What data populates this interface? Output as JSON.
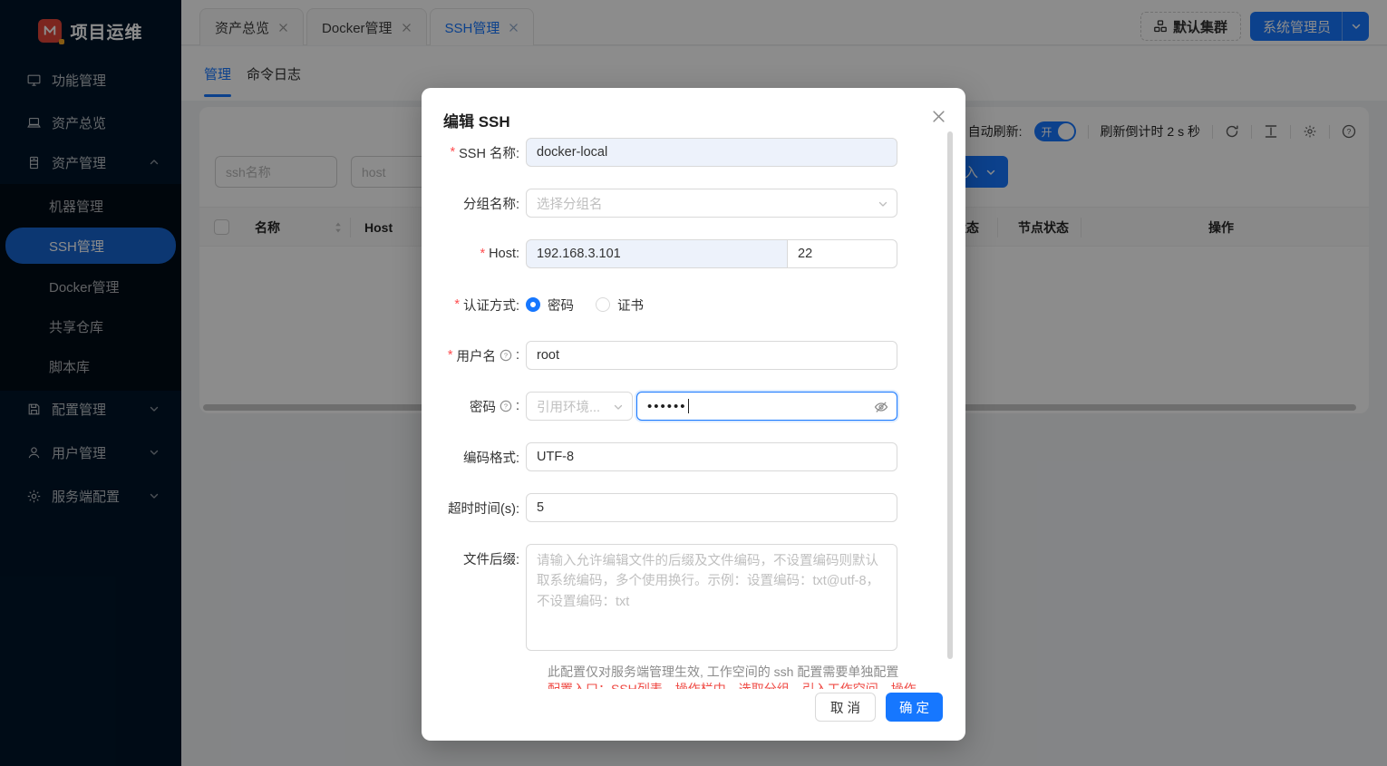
{
  "app": {
    "logo_text": "项目运维"
  },
  "sidebar": {
    "items": [
      {
        "label": "功能管理"
      },
      {
        "label": "资产总览"
      },
      {
        "label": "资产管理"
      },
      {
        "label": "配置管理"
      },
      {
        "label": "用户管理"
      },
      {
        "label": "服务端配置"
      }
    ],
    "submenu": [
      {
        "label": "机器管理"
      },
      {
        "label": "SSH管理"
      },
      {
        "label": "Docker管理"
      },
      {
        "label": "共享仓库"
      },
      {
        "label": "脚本库"
      }
    ]
  },
  "header": {
    "tabs": [
      {
        "label": "资产总览"
      },
      {
        "label": "Docker管理"
      },
      {
        "label": "SSH管理"
      }
    ],
    "cluster_button": "默认集群",
    "user_button": "系统管理员"
  },
  "subtabs": {
    "manage": "管理",
    "logs": "命令日志"
  },
  "toolbar": {
    "auto_refresh_label": "自动刷新:",
    "toggle_on": "开",
    "countdown": "刷新倒计时 2 s 秒"
  },
  "filters": {
    "name_placeholder": "ssh名称",
    "host_placeholder": "host",
    "partial_button": "入"
  },
  "table": {
    "headers": {
      "name": "名称",
      "host": "Host",
      "status": "状态",
      "node_status": "节点状态",
      "actions": "操作"
    }
  },
  "modal": {
    "title": "编辑 SSH",
    "fields": {
      "ssh_name": {
        "required": "*",
        "label": "SSH 名称:",
        "value": "docker-local"
      },
      "group": {
        "label": "分组名称:",
        "placeholder": "选择分组名"
      },
      "host": {
        "required": "*",
        "label": "Host:",
        "value": "192.168.3.101",
        "port": "22"
      },
      "auth": {
        "required": "*",
        "label": "认证方式:",
        "options": [
          {
            "label": "密码"
          },
          {
            "label": "证书"
          }
        ]
      },
      "username": {
        "required": "*",
        "label": "用户名",
        "colon": ":",
        "value": "root"
      },
      "password": {
        "label": "密码",
        "colon": ":",
        "env_placeholder": "引用环境...",
        "value": "••••••"
      },
      "encoding": {
        "label": "编码格式:",
        "value": "UTF-8"
      },
      "timeout": {
        "label": "超时时间(s):",
        "value": "5"
      },
      "suffix": {
        "label": "文件后缀:",
        "placeholder": "请输入允许编辑文件的后缀及文件编码，不设置编码则默认取系统编码，多个使用换行。示例：设置编码：txt@utf-8，不设置编码：txt"
      }
    },
    "notes": {
      "gray": "此配置仅对服务端管理生效, 工作空间的 ssh 配置需要单独配置",
      "red_clipped": "配置入口：SSH列表，操作栏中，选取分组，引入工作空间，操作"
    },
    "footer": {
      "cancel": "取 消",
      "ok": "确 定"
    }
  },
  "colors": {
    "primary": "#1677ff",
    "danger": "#ff4d4f"
  }
}
